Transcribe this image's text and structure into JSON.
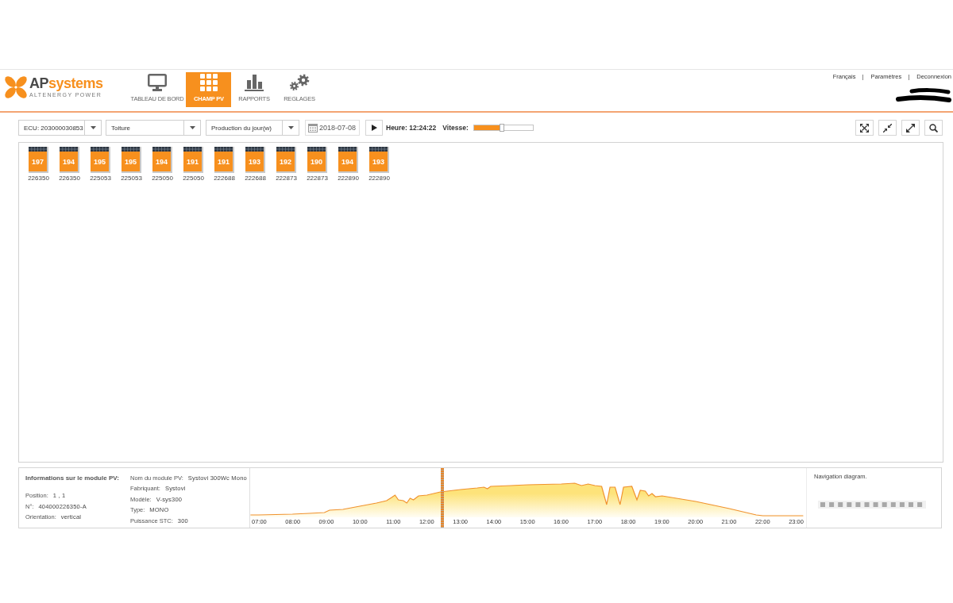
{
  "logo": {
    "prefix": "AP",
    "suffix": "systems",
    "tagline": "ALTENERGY POWER"
  },
  "nav": [
    {
      "label": "TABLEAU DE BORD",
      "selected": false
    },
    {
      "label": "CHAMP PV",
      "selected": true
    },
    {
      "label": "RAPPORTS",
      "selected": false
    },
    {
      "label": "REGLAGES",
      "selected": false
    }
  ],
  "header_links": [
    "Français",
    "Paramètres",
    "Deconnexion"
  ],
  "toolbar": {
    "ecu": "ECU: 203000030853",
    "layer": "Toiture",
    "metric": "Production du jour(w)",
    "date": "2018-07-08",
    "time": "Heure: 12:24:22",
    "speed": {
      "label": "Vitesse:",
      "level": 0.47
    }
  },
  "panels": [
    {
      "value": "197",
      "label": "226350"
    },
    {
      "value": "194",
      "label": "226350"
    },
    {
      "value": "195",
      "label": "225053"
    },
    {
      "value": "195",
      "label": "225053"
    },
    {
      "value": "194",
      "label": "225050"
    },
    {
      "value": "191",
      "label": "225050"
    },
    {
      "value": "191",
      "label": "222688"
    },
    {
      "value": "193",
      "label": "222688"
    },
    {
      "value": "192",
      "label": "222873"
    },
    {
      "value": "190",
      "label": "222873"
    },
    {
      "value": "194",
      "label": "222890"
    },
    {
      "value": "193",
      "label": "222890"
    }
  ],
  "module_info": {
    "title": "Informations sur le module PV:",
    "details": [
      {
        "label": "Position:",
        "value": "1 , 1"
      },
      {
        "label": "N°:",
        "value": "404000226350-A"
      },
      {
        "label": "Orientation:",
        "value": "vertical"
      }
    ],
    "specs": [
      {
        "label": "Nom du module PV:",
        "value": "Systovi 300Wc Mono"
      },
      {
        "label": "Fabriquant:",
        "value": "Systovi"
      },
      {
        "label": "Modèle:",
        "value": "V-sys300"
      },
      {
        "label": "Type:",
        "value": "MONO"
      },
      {
        "label": "Puissance STC:",
        "value": "300"
      }
    ]
  },
  "production_chart": {
    "time_labels": [
      "07:00",
      "08:00",
      "09:00",
      "10:00",
      "11:00",
      "12:00",
      "13:00",
      "14:00",
      "15:00",
      "16:00",
      "17:00",
      "18:00",
      "19:00",
      "20:00",
      "21:00",
      "22:00",
      "23:00"
    ]
  },
  "navigation": {
    "title": "Navigation diagram."
  }
}
